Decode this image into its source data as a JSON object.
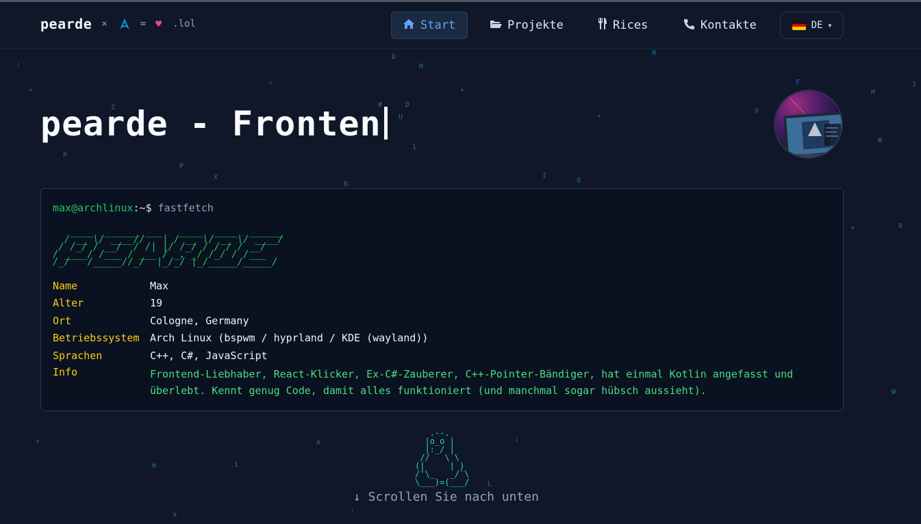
{
  "brand": {
    "name": "pearde",
    "times": "×",
    "equals": "=",
    "heart": "♥",
    "tld": ".lol"
  },
  "nav": {
    "items": [
      {
        "label": "Start",
        "icon": "home-icon",
        "active": true
      },
      {
        "label": "Projekte",
        "icon": "folder-open-icon",
        "active": false
      },
      {
        "label": "Rices",
        "icon": "utensils-icon",
        "active": false
      },
      {
        "label": "Kontakte",
        "icon": "phone-icon",
        "active": false
      }
    ],
    "language": "DE"
  },
  "hero": {
    "title": "pearde - Fronten"
  },
  "terminal": {
    "user": "max@archlinux",
    "path": ":~$",
    "command": "fastfetch",
    "logo": "   ____  ______ ___   ____  ____  ______\n  / __ \\/ ____//   | / __ \\/ __ \\/ ____/\n / /_/ / __/  / /| |/ /_/ / / / / __/   \n/ ____/ /___ / ___ / _, _/ /_/ / /___   \n/_/   /_____//_/  |_/_/ |_/_____/_____/   ",
    "info": [
      {
        "key": "Name",
        "value": "Max"
      },
      {
        "key": "Alter",
        "value": "19"
      },
      {
        "key": "Ort",
        "value": "Cologne, Germany"
      },
      {
        "key": "Betriebssystem",
        "value": "Arch Linux (bspwm / hyprland / KDE (wayland))"
      },
      {
        "key": "Sprachen",
        "value": "C++, C#, JavaScript"
      },
      {
        "key": "Info",
        "value": "Frontend-Liebhaber, React-Klicker, Ex-C#-Zauberer, C++-Pointer-Bändiger, hat einmal Kotlin angefasst und überlebt. Kennt genug Code, damit alles funktioniert (und manchmal sogar hübsch aussieht)."
      }
    ]
  },
  "tux": "   .--.\n  |o_o |\n  |:_/ |\n //   \\ \\\n(|     | )\n/'\\_   _/`\\\n\\___)=(___/",
  "scroll_hint": "↓ Scrollen Sie nach unten",
  "rain": [
    ";",
    "*",
    "Z",
    "P",
    "P",
    "X",
    "*",
    "#",
    "D",
    "U",
    "1",
    "B",
    "D",
    "M",
    "*",
    "I",
    "Q",
    "*",
    "N",
    "V",
    "F",
    "M",
    "1",
    "W",
    "+",
    "0",
    "W",
    "*",
    "H",
    "1",
    "X",
    ";",
    "L",
    ":",
    "X"
  ]
}
